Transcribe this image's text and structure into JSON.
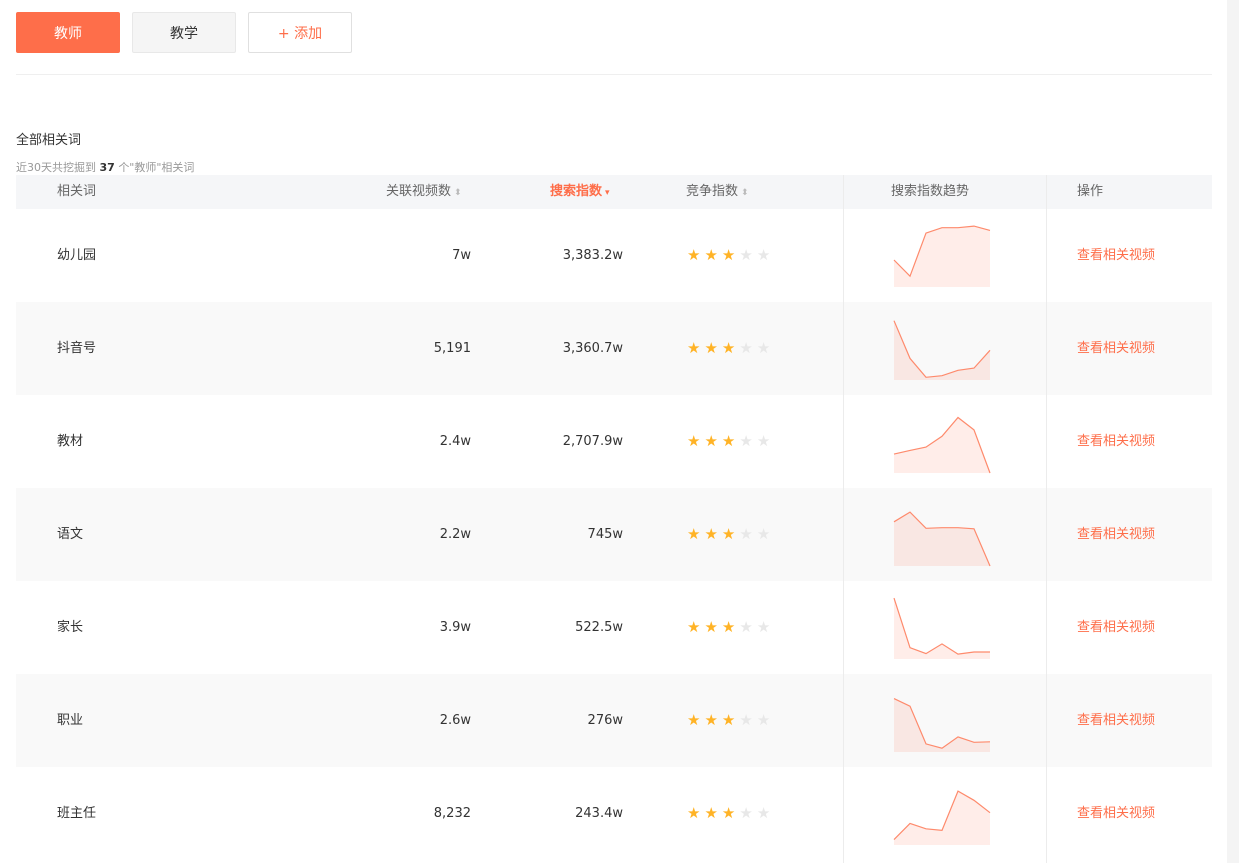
{
  "tabs": [
    {
      "label": "教师",
      "active": true
    },
    {
      "label": "教学",
      "active": false
    }
  ],
  "add_tab_label": "+ 添加",
  "section": {
    "title": "全部相关词",
    "subtitle_pre": "近30天共挖掘到",
    "subtitle_count": "37",
    "subtitle_post": "个\"教师\"相关词"
  },
  "table": {
    "columns": {
      "word": "相关词",
      "videos": "关联视频数",
      "search": "搜索指数",
      "competition": "竞争指数",
      "trend": "搜索指数趋势",
      "action": "操作"
    },
    "sort_icon": "⬍",
    "sort_icon_active": "▾",
    "action_label": "查看相关视频",
    "rows": [
      {
        "word": "幼儿园",
        "videos": "7w",
        "search": "3,383.2w",
        "stars": 3,
        "trend": [
          50,
          20,
          100,
          110,
          110,
          113,
          105
        ]
      },
      {
        "word": "抖音号",
        "videos": "5,191",
        "search": "3,360.7w",
        "stars": 3,
        "trend": [
          110,
          40,
          5,
          8,
          18,
          22,
          55
        ]
      },
      {
        "word": "教材",
        "videos": "2.4w",
        "search": "2,707.9w",
        "stars": 3,
        "trend": [
          35,
          42,
          48,
          68,
          103,
          80,
          0
        ]
      },
      {
        "word": "语文",
        "videos": "2.2w",
        "search": "745w",
        "stars": 3,
        "trend": [
          82,
          100,
          70,
          71,
          71,
          69,
          0
        ]
      },
      {
        "word": "家长",
        "videos": "3.9w",
        "search": "522.5w",
        "stars": 3,
        "trend": [
          113,
          21,
          10,
          28,
          9,
          13,
          13
        ]
      },
      {
        "word": "职业",
        "videos": "2.6w",
        "search": "276w",
        "stars": 3,
        "trend": [
          99,
          85,
          15,
          7,
          28,
          18,
          19
        ]
      },
      {
        "word": "班主任",
        "videos": "8,232",
        "search": "243.4w",
        "stars": 3,
        "trend": [
          10,
          40,
          30,
          27,
          100,
          83,
          60
        ]
      }
    ]
  },
  "colors": {
    "accent": "#fe6e4a",
    "star": "#ffb326",
    "star_empty": "#e8e8e8"
  }
}
